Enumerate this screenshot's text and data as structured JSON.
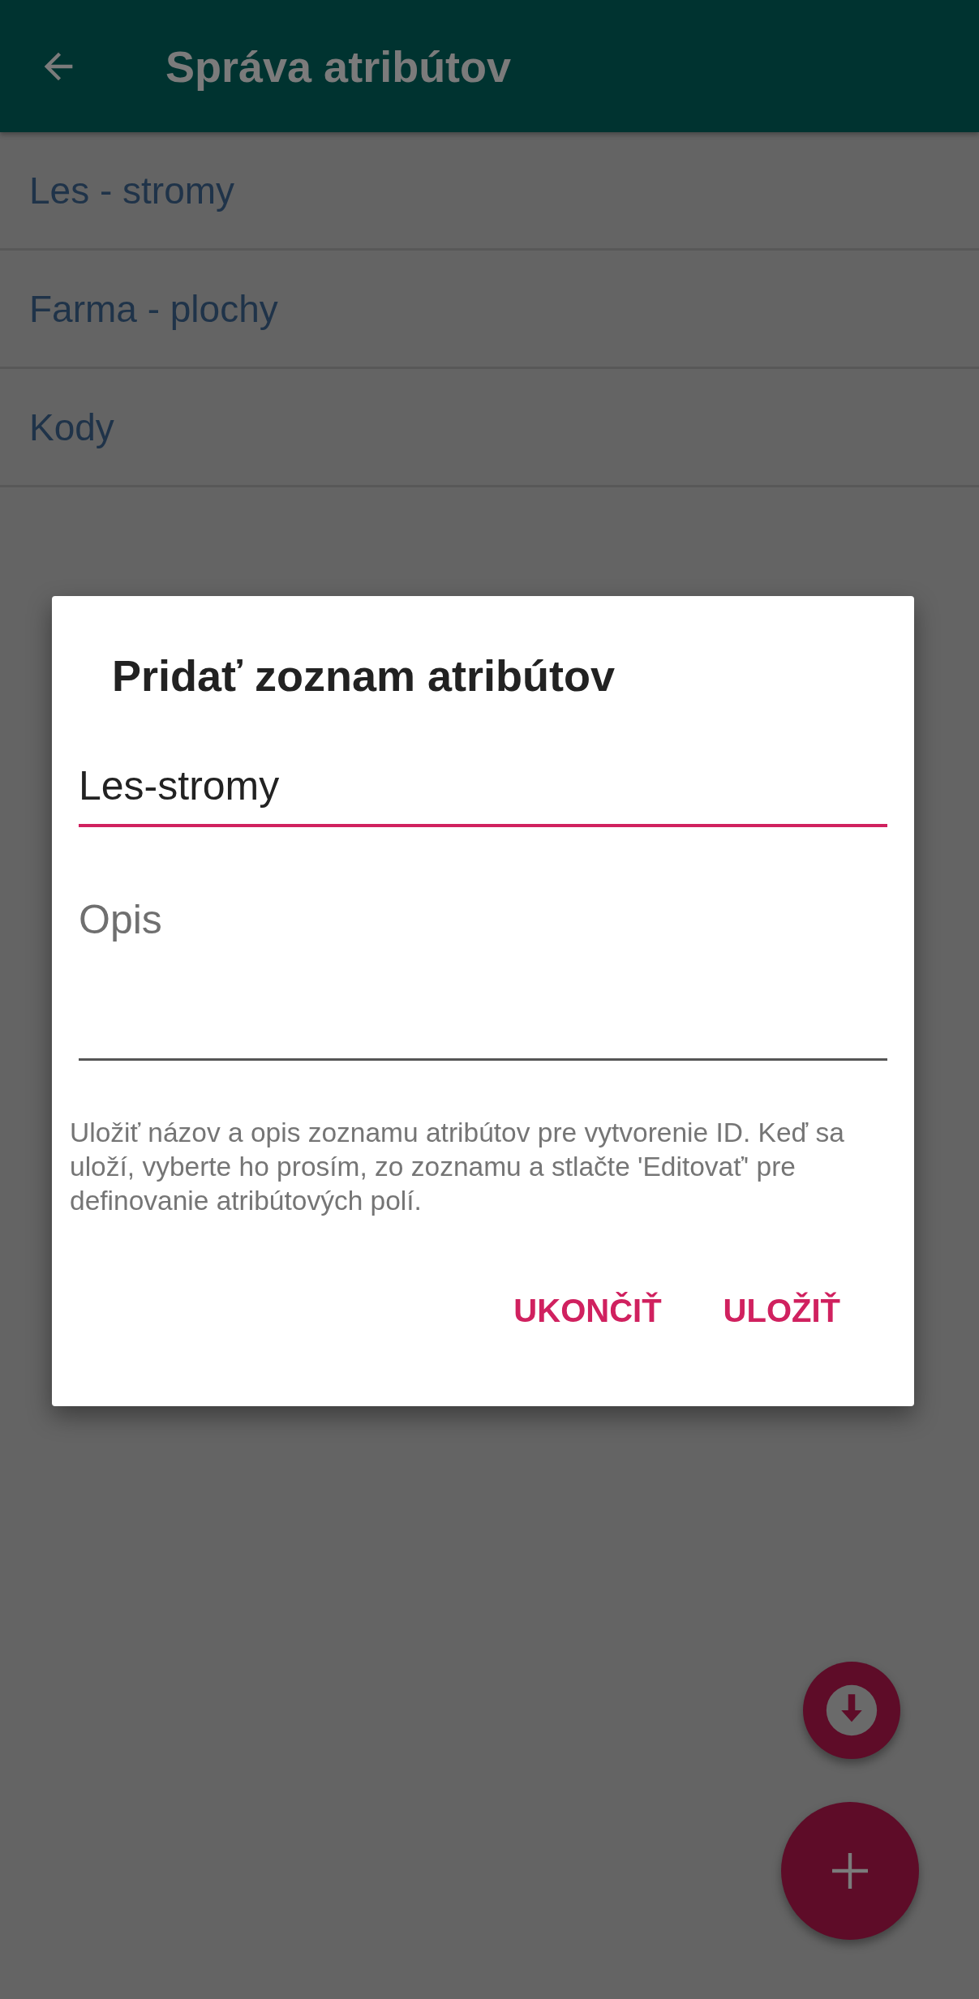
{
  "app_bar": {
    "title": "Správa atribútov"
  },
  "list": [
    {
      "label": "Les - stromy"
    },
    {
      "label": "Farma - plochy"
    },
    {
      "label": "Kody"
    }
  ],
  "dialog": {
    "title": "Pridať zoznam atribútov",
    "name_field": {
      "value": "Les-stromy",
      "focused": true
    },
    "description_field": {
      "placeholder": "Opis",
      "focused": false
    },
    "help_text": "Uložiť názov a opis zoznamu atribútov pre vytvorenie ID. Keď sa uloží, vyberte ho prosím, zo zoznamu a stlačte 'Editovať' pre definovanie atribútových polí.",
    "buttons": [
      {
        "label": "UKONČIŤ"
      },
      {
        "label": "ULOŽIŤ"
      }
    ]
  }
}
